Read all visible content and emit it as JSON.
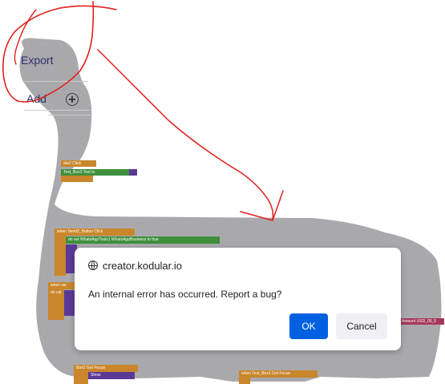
{
  "toolbar": {
    "export_label": "Export",
    "add_label": "Add"
  },
  "blocks": {
    "b1": "ata2    Click",
    "b2": "Text_Box3     Text    to",
    "b3": "when  Send2_Button  Click",
    "b4": "do   set  WhatsAppTools1   WhatsAppBusiness   to   true",
    "b5": "when  sw",
    "b6": "do  cal",
    "b7": "Amount   USD_00_5",
    "b8": "Box2    Got Focus",
    "b9": "Show",
    "b10": "when  Text_Box1    Got Focus"
  },
  "dialog": {
    "origin": "creator.kodular.io",
    "message": "An internal error has occurred. Report a bug?",
    "ok_label": "OK",
    "cancel_label": "Cancel"
  },
  "colors": {
    "workspace": "#a9a9ad",
    "annotation": "#e0201c",
    "primary_button": "#0060df"
  },
  "icons": {
    "add": "plus-circle-icon",
    "origin": "globe-icon"
  }
}
